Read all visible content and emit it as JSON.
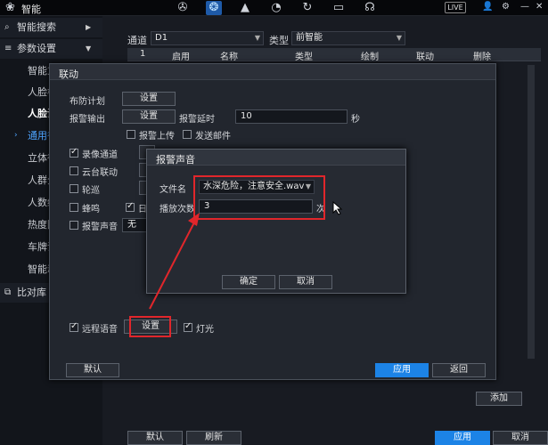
{
  "topbar": {
    "title": "智能",
    "live_label": "LIVE",
    "icons": [
      "preview-icon",
      "smart-brain-icon",
      "bell-icon",
      "speedometer-icon",
      "refresh-icon",
      "monitor-icon",
      "headphones-icon"
    ]
  },
  "sidebar": {
    "groups": [
      {
        "label": "智能搜索",
        "icon": "search-icon"
      },
      {
        "label": "参数设置",
        "icon": "list-icon"
      },
      {
        "label": "比对库",
        "icon": "database-icon"
      }
    ],
    "sub_items": [
      "智能方",
      "人脸检",
      "人脸识",
      "通用行",
      "立体行",
      "人群分",
      "人数统",
      "热度图",
      "车牌识",
      "智能动"
    ]
  },
  "main": {
    "channel_label": "通道",
    "channel_value": "D1",
    "type_label": "类型",
    "type_value": "前智能",
    "columns": [
      "1",
      "启用",
      "名称",
      "类型",
      "绘制",
      "联动",
      "删除"
    ],
    "add_button": "添加",
    "default_button": "默认",
    "refresh_button": "刷新",
    "apply_button": "应用",
    "cancel_button": "取消"
  },
  "linkage_dialog": {
    "title": "联动",
    "schedule_label": "布防计划",
    "set_label": "设置",
    "alarm_out_label": "报警输出",
    "alarm_delay_label": "报警延时",
    "alarm_delay_value": "10",
    "seconds_unit": "秒",
    "alarm_upload_label": "报警上传",
    "send_mail_label": "发送邮件",
    "record_channel_label": "录像通道",
    "ptz_label": "云台联动",
    "tour_label": "轮巡",
    "buzzer_label": "蜂鸣",
    "log_label": "日",
    "alarm_sound_label": "报警声音",
    "alarm_sound_value": "无",
    "remote_voice_label": "远程语音",
    "light_label": "灯光",
    "default_button": "默认",
    "apply_button": "应用",
    "back_button": "返回"
  },
  "sound_dialog": {
    "title": "报警声音",
    "file_label": "文件名",
    "file_value": "水深危险，注意安全.wav",
    "play_count_label": "播放次数",
    "play_count_value": "3",
    "count_unit": "次",
    "ok_button": "确定",
    "cancel_button": "取消"
  },
  "colors": {
    "accent": "#1c83e6",
    "annotation_red": "#e1262b"
  }
}
